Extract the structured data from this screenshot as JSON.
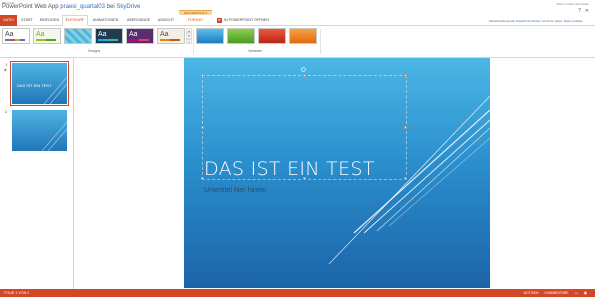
{
  "titlebar": {
    "brand": "Microsoft",
    "app_name": "PowerPoint Web App",
    "file_name": "praesi_quartal03",
    "at_label": "bei",
    "location": "SkyDrive",
    "user": "Martin Gruber Abmelden",
    "help_icon": "?",
    "close_icon": "✕"
  },
  "ribbon": {
    "tabs": [
      "DATEI",
      "START",
      "EINFÜGEN",
      "ENTWURF",
      "ANIMATIONEN",
      "ÜBERGÄNGE",
      "ANSICHT",
      "FORMAT"
    ],
    "active_tab": "ENTWURF",
    "context_label": "ZEICHENTOOLS",
    "open_ppt_label": "IN POWERPOINT ÖFFNEN",
    "notice": "Weiterbearbeitende PowerPoint-Nutzer mit Ihnen teilen: Datei erstellen",
    "groups": [
      {
        "label": "Designs"
      },
      {
        "label": "Varianten"
      }
    ],
    "theme_aa": "Aa"
  },
  "slides": [
    {
      "number": "1",
      "star": "✱",
      "mini_title": "DAS IST EIN TEST",
      "selected": true
    },
    {
      "number": "2",
      "star": "",
      "mini_title": "",
      "selected": false
    }
  ],
  "slide": {
    "title": "DAS IST EIN TEST",
    "subtitle": "Untertitel hier hinein"
  },
  "status": {
    "slide_info": "FOLIE 1 VON 2",
    "notes": "NOTIZEN",
    "comments": "KOMMENTARE"
  },
  "colors": {
    "accent": "#d24726",
    "slide_top": "#4cb6e6",
    "slide_bottom": "#1b64a8"
  }
}
